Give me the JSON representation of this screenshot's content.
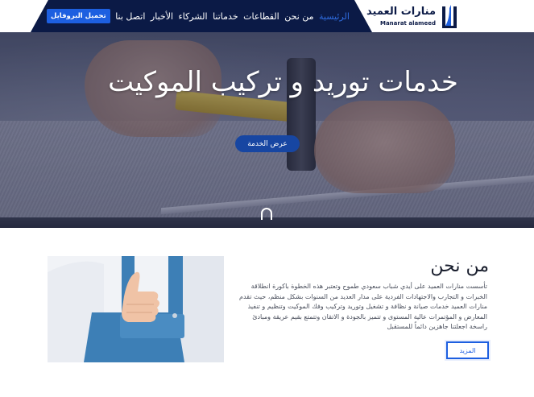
{
  "header": {
    "logo_ar": "منارات العميد",
    "logo_en": "Manarat alameed",
    "nav": [
      {
        "label": "الرئيسية",
        "active": true
      },
      {
        "label": "من نحن",
        "active": false
      },
      {
        "label": "القطاعات",
        "active": false
      },
      {
        "label": "خدماتنا",
        "active": false
      },
      {
        "label": "الشركاء",
        "active": false
      },
      {
        "label": "الأخبار",
        "active": false
      },
      {
        "label": "اتصل بنا",
        "active": false
      }
    ],
    "cta_label": "تحميل البروفايل"
  },
  "hero": {
    "title": "خدمات توريد و تركيب الموكيت",
    "button_label": "عرض الخدمة",
    "scroll_icon": "scroll-down-icon"
  },
  "about": {
    "title": "من نحن",
    "text": "تأسست منارات العميد على أيدي شباب سعودي طموح وتعتبر هذه الخطوة باكورة انطلاقة الخبرات و التجارب والاجتهادات الفردية على مدار العديد من السنوات بشكل منظم، حيث تقدم منارات العميد خدمات صيانة و نظافة و تشغيل وتوريد وتركيب وفك الموكيت وتنظيم و تنفيذ المعارض و المؤتمرات عالية المستوى و تتميز بالجودة و الاتقان وتتمتع بقيم عريقة ومبادئ راسخة اجعلتنا جاهزين دائماً للمستقبل",
    "more_label": "المزيد"
  },
  "colors": {
    "navy": "#0b1a46",
    "accent": "#1d5fe0",
    "active_nav": "#2f6cdf",
    "hero_button": "#1746a2"
  }
}
